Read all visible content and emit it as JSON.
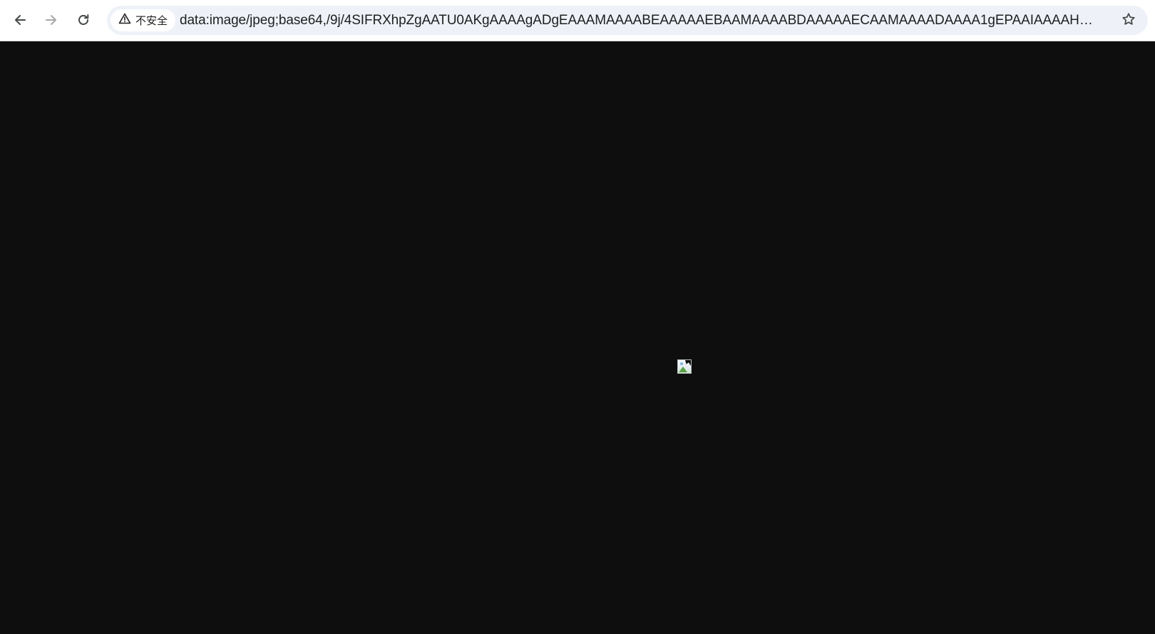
{
  "browser": {
    "toolbar": {
      "back_icon": "arrow-left-icon",
      "forward_icon": "arrow-right-icon",
      "reload_icon": "reload-icon",
      "bookmark_icon": "star-outline-icon"
    },
    "omnibox": {
      "security_icon": "warning-triangle-icon",
      "security_label": "不安全",
      "url": "data:image/jpeg;base64,/9j/4SIFRXhpZgAATU0AKgAAAAgADgEAAAMAAAABEAAAAAEBAAMAAAABDAAAAAECAAMAAAADAAAA1gEPAAIAAAAHAAAAt..."
    }
  },
  "page": {
    "background_color": "#0e0e0e",
    "content": {
      "broken_image_icon": "broken-image-icon"
    }
  }
}
